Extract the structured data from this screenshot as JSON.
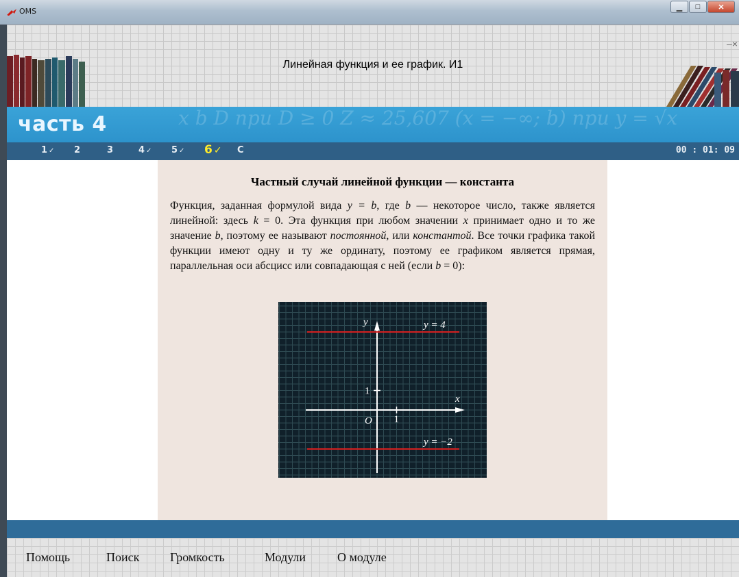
{
  "window": {
    "title": "OMS"
  },
  "header": {
    "course_title": "Линейная функция и ее график. И1"
  },
  "band": {
    "part_title": "часть 4",
    "bg_formula": "x  b  D  при D ≥ 0   Z ≈ 25,607  (x = −∞; b)   при   y = √x"
  },
  "nav": {
    "items": [
      {
        "label": "1",
        "check": "✓"
      },
      {
        "label": "2",
        "check": ""
      },
      {
        "label": "3",
        "check": ""
      },
      {
        "label": "4",
        "check": "✓"
      },
      {
        "label": "5",
        "check": "✓"
      },
      {
        "label": "6",
        "check": "✓"
      },
      {
        "label": "C",
        "check": ""
      }
    ],
    "active_index": 5,
    "timer": "00 : 01: 09"
  },
  "content": {
    "heading": "Частный случай линейной функции — константа",
    "para": {
      "t1": "Функция, заданная формулой вида ",
      "f1": "y = b",
      "t2": ", где ",
      "f2": "b",
      "t3": " — некоторое число, также является линейной: здесь ",
      "f3": "k",
      "t4": " = 0. Эта функция при любом значении ",
      "f4": "x",
      "t5": " принимает одно и то же значение ",
      "f5": "b",
      "t6": ", поэтому ее называют ",
      "f6": "постоянной",
      "t7": ", или ",
      "f7": "константой",
      "t8": ". Все точки графика такой функции имеют одну и ту же ординату, поэтому ее графиком является прямая, параллельная оси абсцисс или совпадающая с ней (если ",
      "f8": "b",
      "t9": " = 0):"
    }
  },
  "graph": {
    "y_axis_label": "y",
    "x_axis_label": "x",
    "origin_label": "O",
    "unit_x_label": "1",
    "unit_y_label": "1",
    "lines": [
      {
        "label": "y = 4",
        "b": 4
      },
      {
        "label": "y = −2",
        "b": -2
      }
    ],
    "line_color": "#d42020",
    "axis_color": "#ffffff",
    "grid_color": "#2e4a52"
  },
  "footer": {
    "menu": [
      "Помощь",
      "Поиск",
      "Громкость",
      "Модули",
      "О модуле"
    ]
  }
}
